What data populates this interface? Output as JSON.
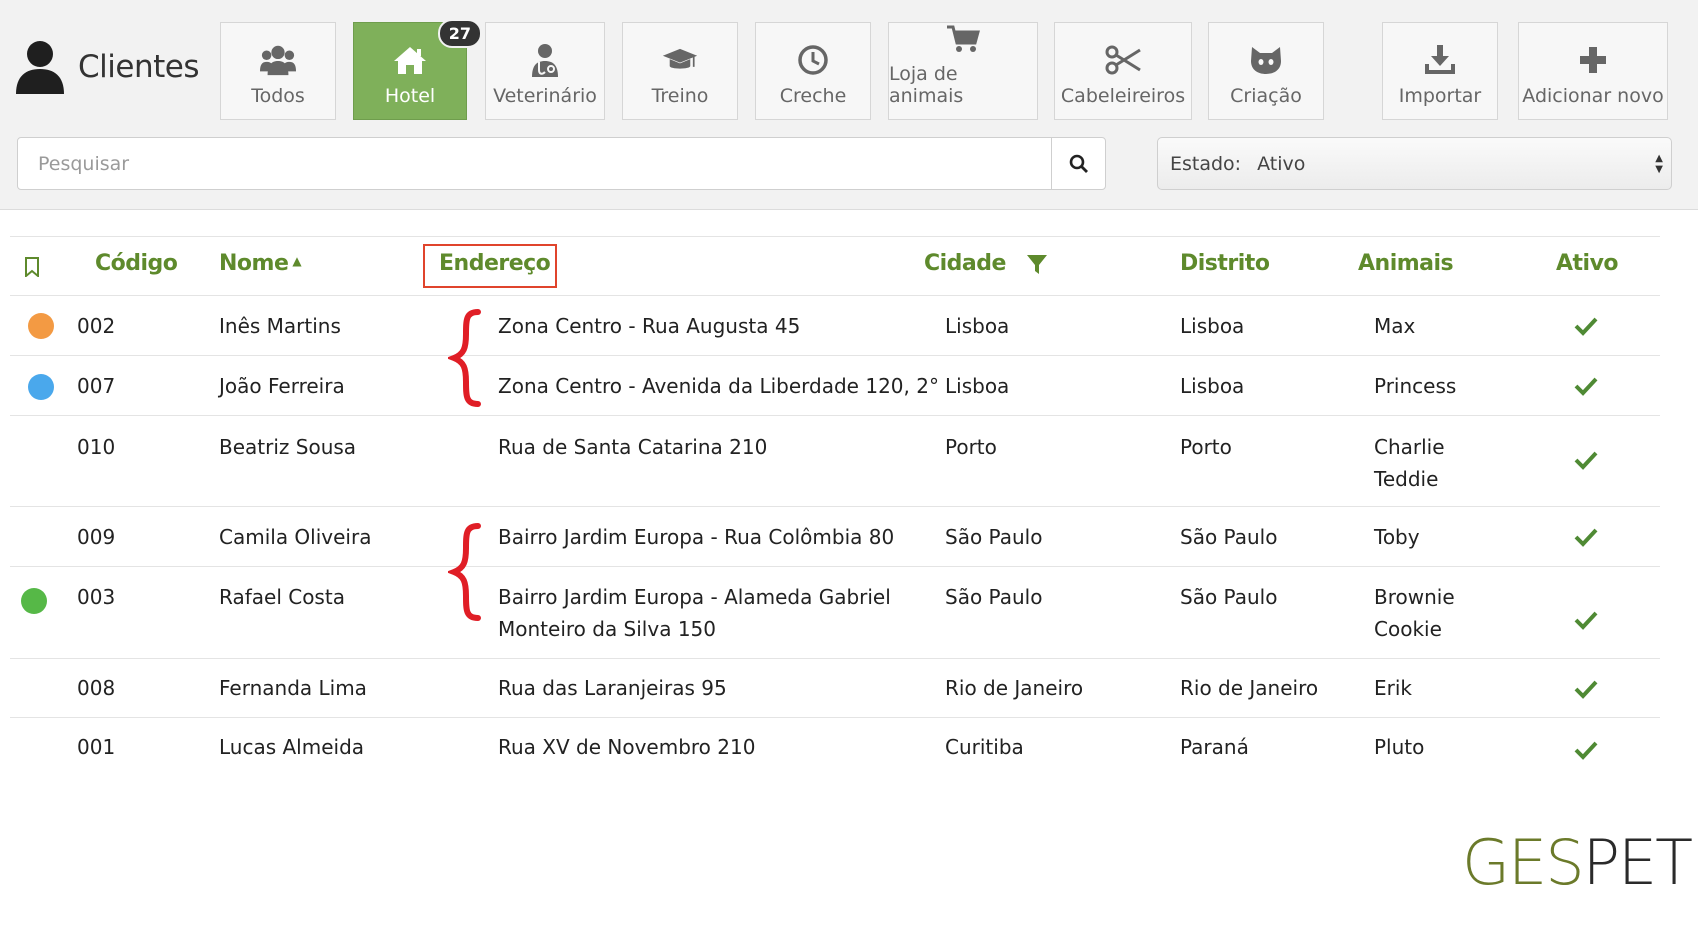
{
  "app": {
    "title": "Clientes"
  },
  "tabs": [
    {
      "label": "Todos",
      "icon": "users-icon",
      "active": false
    },
    {
      "label": "Hotel",
      "icon": "home-icon",
      "active": true,
      "badge": "27"
    },
    {
      "label": "Veterinário",
      "icon": "stethoscope-icon",
      "active": false
    },
    {
      "label": "Treino",
      "icon": "graduation-cap-icon",
      "active": false
    },
    {
      "label": "Creche",
      "icon": "clock-icon",
      "active": false
    },
    {
      "label": "Loja de animais",
      "icon": "cart-icon",
      "active": false
    },
    {
      "label": "Cabeleireiros",
      "icon": "scissors-icon",
      "active": false
    },
    {
      "label": "Criação",
      "icon": "cat-face-icon",
      "active": false
    },
    {
      "label": "Importar",
      "icon": "download-icon",
      "active": false
    },
    {
      "label": "Adicionar novo",
      "icon": "plus-icon",
      "active": false
    }
  ],
  "search": {
    "placeholder": "Pesquisar",
    "value": ""
  },
  "filter": {
    "label": "Estado:",
    "value": "Ativo"
  },
  "table": {
    "columns": [
      "Código",
      "Nome",
      "Endereço",
      "Cidade",
      "Distrito",
      "Animais",
      "Ativo"
    ],
    "sorted_by": "Nome",
    "rows": [
      {
        "dot": "#f39a43",
        "code": "002",
        "name": "Inês Martins",
        "address": [
          "Zona Centro - Rua Augusta 45"
        ],
        "city": "Lisboa",
        "district": "Lisboa",
        "animals": [
          "Max"
        ],
        "active": true
      },
      {
        "dot": "#4aa8ec",
        "code": "007",
        "name": "João Ferreira",
        "address": [
          "Zona Centro - Avenida da Liberdade 120, 2°"
        ],
        "city": "Lisboa",
        "district": "Lisboa",
        "animals": [
          "Princess"
        ],
        "active": true
      },
      {
        "dot": "",
        "code": "010",
        "name": "Beatriz Sousa",
        "address": [
          "Rua de Santa Catarina 210"
        ],
        "city": "Porto",
        "district": "Porto",
        "animals": [
          "Charlie",
          "Teddie"
        ],
        "active": true
      },
      {
        "dot": "",
        "code": "009",
        "name": "Camila Oliveira",
        "address": [
          "Bairro Jardim Europa - Rua Colômbia 80"
        ],
        "city": "São Paulo",
        "district": "São Paulo",
        "animals": [
          "Toby"
        ],
        "active": true
      },
      {
        "dot": "#56b847",
        "code": "003",
        "name": "Rafael Costa",
        "address": [
          "Bairro Jardim Europa - Alameda Gabriel",
          "Monteiro da Silva 150"
        ],
        "city": "São Paulo",
        "district": "São Paulo",
        "animals": [
          "Brownie",
          "Cookie"
        ],
        "active": true
      },
      {
        "dot": "",
        "code": "008",
        "name": "Fernanda Lima",
        "address": [
          "Rua das Laranjeiras 95"
        ],
        "city": "Rio de Janeiro",
        "district": "Rio de Janeiro",
        "animals": [
          "Erik"
        ],
        "active": true
      },
      {
        "dot": "",
        "code": "001",
        "name": "Lucas Almeida",
        "address": [
          "Rua XV de Novembro 210"
        ],
        "city": "Curitiba",
        "district": "Paraná",
        "animals": [
          "Pluto"
        ],
        "active": true
      }
    ]
  },
  "logo": {
    "part1": "GES",
    "part2": "PET"
  },
  "colors": {
    "accent": "#5e8a2c",
    "active_tab": "#7fb05a",
    "annotation": "#e0442c",
    "brace": "#e01e26",
    "check": "#4f8a34"
  }
}
